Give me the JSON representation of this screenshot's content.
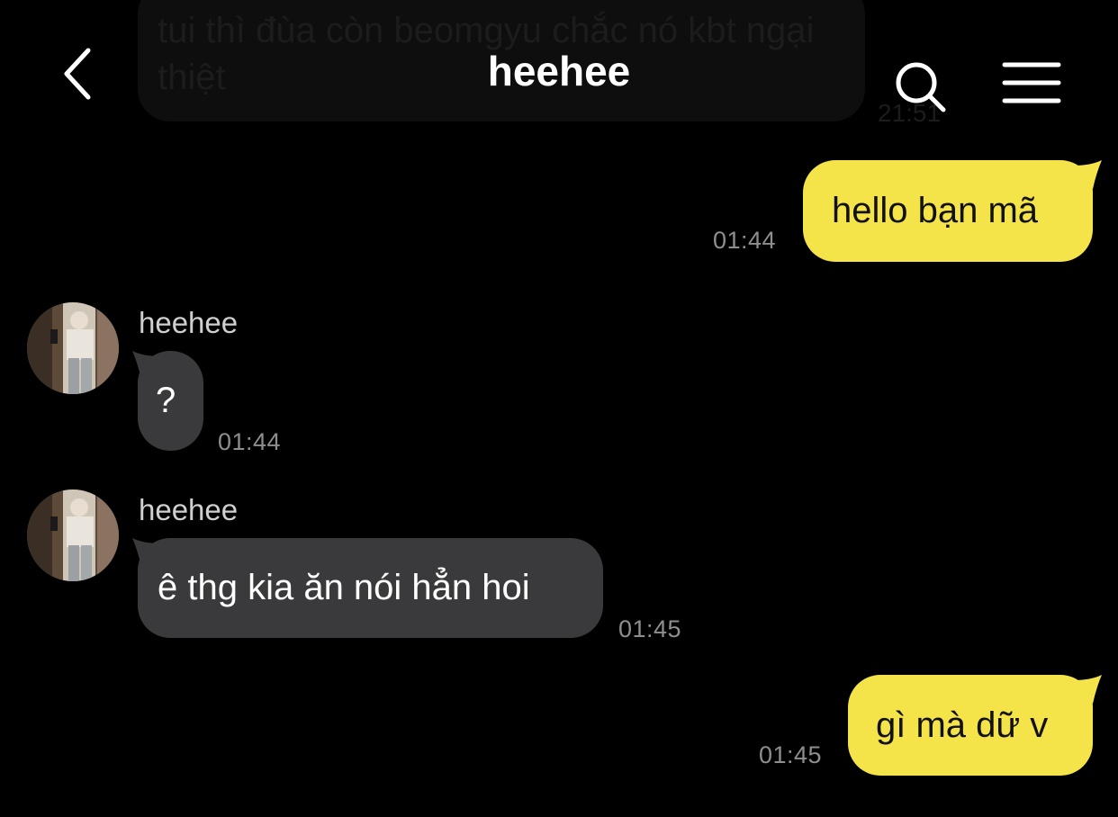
{
  "previous_message": {
    "text": "tui thì đùa còn beomgyu chắc nó kbt ngại thiệt",
    "time": "21:51"
  },
  "header": {
    "title": "heehee",
    "icons": [
      "chevron-left-icon",
      "search-icon",
      "menu-icon"
    ]
  },
  "messages": [
    {
      "direction": "out",
      "text": "hello bạn mã",
      "time": "01:44"
    },
    {
      "direction": "in",
      "sender": "heehee",
      "text": "?",
      "time": "01:44"
    },
    {
      "direction": "in",
      "sender": "heehee",
      "text": "ê thg kia ăn nói hẳn hoi",
      "time": "01:45"
    },
    {
      "direction": "out",
      "text": "gì mà dữ v",
      "time": "01:45"
    }
  ],
  "colors": {
    "background": "#000000",
    "outgoing_bubble": "#f5e34a",
    "incoming_bubble": "#3a3a3c",
    "timestamp": "#8e8e8e"
  }
}
